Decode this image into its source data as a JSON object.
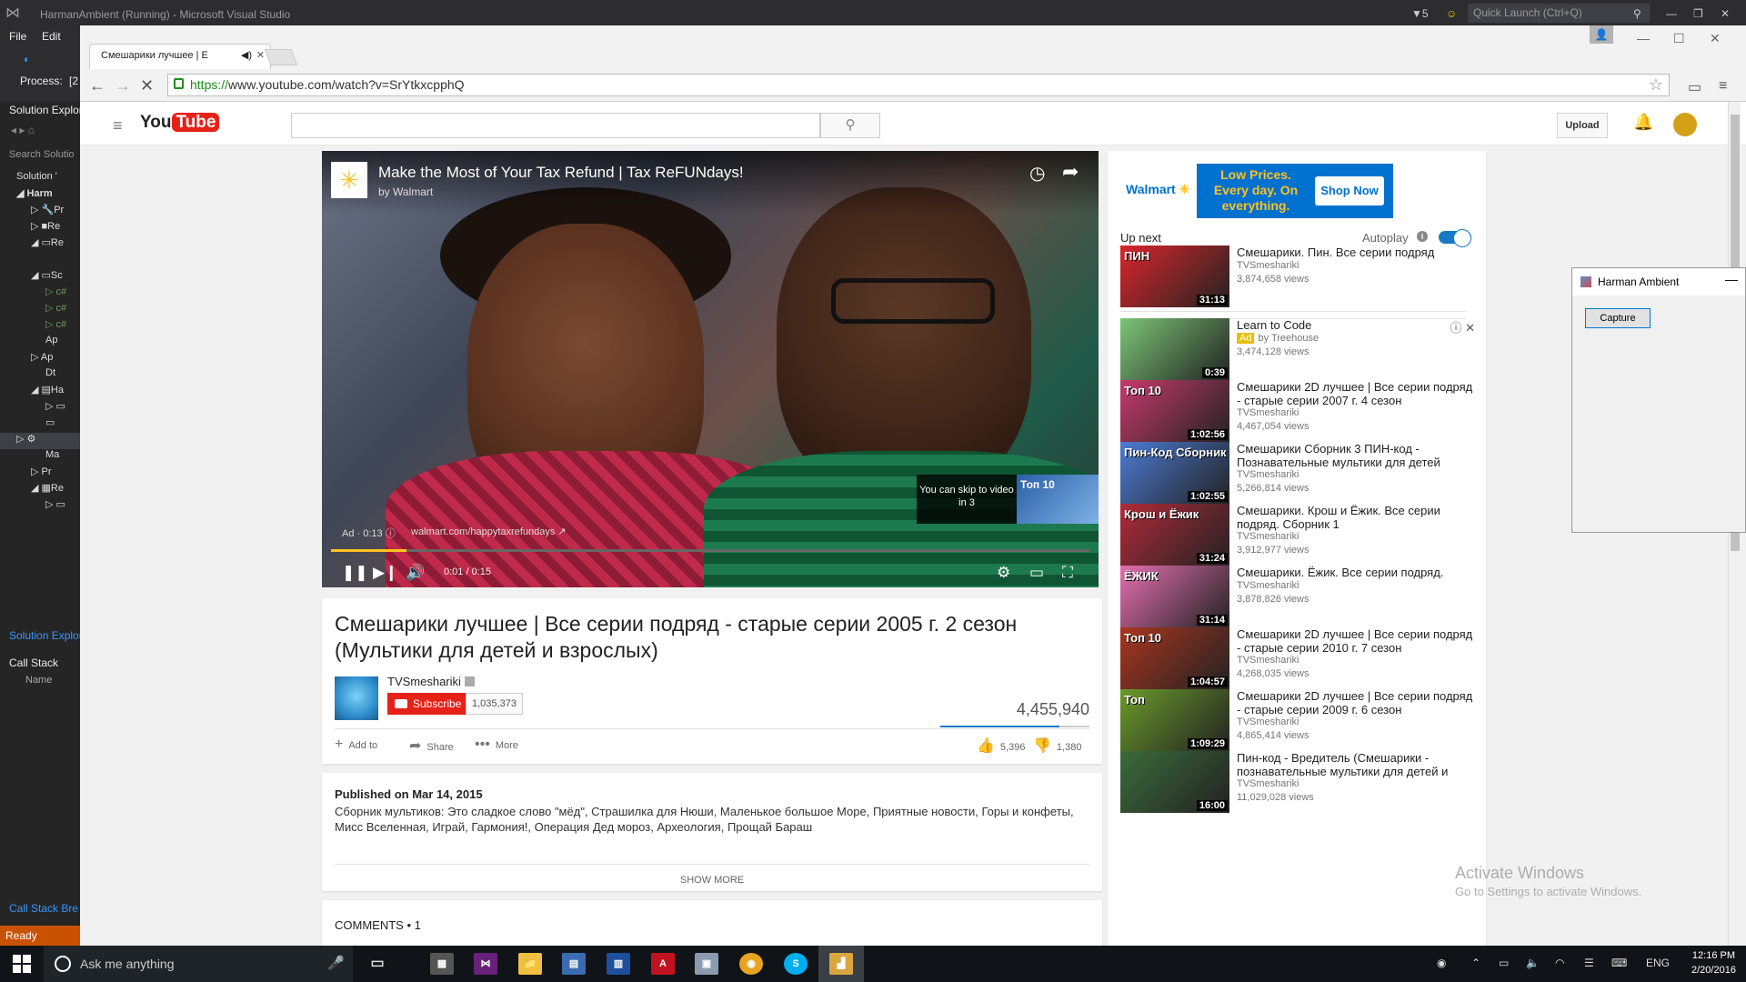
{
  "vs": {
    "title": "HarmanAmbient (Running) - Microsoft Visual Studio",
    "filter_count": "5",
    "quick_launch": "Quick Launch (Ctrl+Q)",
    "menu": [
      "File",
      "Edit"
    ],
    "process_label": "Process:",
    "process_value": "[2",
    "solution_explorer_title": "Solution Explor",
    "search_solution": "Search Solutio",
    "tree": [
      "Solution '",
      "Harm",
      "Pr",
      "Re",
      "Re",
      "",
      "Sc",
      "",
      "",
      "",
      "Ap",
      "Ap",
      "Dt",
      "Ha",
      "",
      "",
      "",
      "Ma",
      "Pr",
      "Re",
      ""
    ],
    "solution_tab": "Solution Explor",
    "call_stack_title": "Call Stack",
    "call_stack_col": "Name",
    "bottom_tabs": "Call Stack  Bre",
    "status": "Ready"
  },
  "browser": {
    "tab_title": "Смешарики лучшее | Е",
    "url_scheme": "https://",
    "url_rest": "www.youtube.com/watch?v=SrYtkxcpphQ"
  },
  "youtube": {
    "logo_you": "You",
    "logo_tube": "Tube",
    "search_placeholder": "",
    "upload": "Upload",
    "player": {
      "ad_title": "Make the Most of Your Tax Refund | Tax ReFUNdays!",
      "ad_by": "by Walmart",
      "skip_text": "You can skip to video in 3",
      "skip_thumb_text": "Топ 10",
      "ad_info": "Ad · 0:13",
      "ad_link": "walmart.com/happytaxrefundays",
      "time": "0:01 / 0:15",
      "progress": 0.1
    },
    "video": {
      "title": "Смешарики лучшее | Все серии подряд - старые серии 2005 г. 2 сезон (Мультики для детей и взрослых)",
      "channel": "TVSmeshariki",
      "subscribe": "Subscribe",
      "subscribers": "1,035,373",
      "views": "4,455,940",
      "like_ratio": 0.8,
      "add_to": "Add to",
      "share": "Share",
      "more": "More",
      "likes": "5,396",
      "dislikes": "1,380"
    },
    "description": {
      "published": "Published on Mar 14, 2015",
      "text": "Сборник мультиков: Это сладкое слово \"мёд\", Страшилка для Нюши, Маленькое большое Море, Приятные новости, Горы и конфеты, Мисс Вселенная, Играй, Гармония!, Операция Дед мороз, Археология, Прощай Бараш",
      "show_more": "SHOW MORE"
    },
    "comments": "COMMENTS • 1",
    "sidebar": {
      "banner_brand": "Walmart",
      "banner_tagline": "Low Prices. Every day. On everything.",
      "banner_cta": "Shop Now",
      "up_next": "Up next",
      "autoplay": "Autoplay",
      "videos": [
        {
          "title": "Смешарики. Пин. Все серии подряд",
          "channel": "TVSmeshariki",
          "views": "3,874,658 views",
          "duration": "31:13",
          "thumb_text": "ПИН",
          "color": "#d8262b"
        },
        {
          "title": "Learn to Code",
          "ad": "Ad",
          "channel": "by Treehouse",
          "views": "3,474,128 views",
          "duration": "0:39",
          "thumb_text": "",
          "color": "#7cc576"
        },
        {
          "title": "Смешарики 2D лучшее | Все серии подряд - старые серии 2007 г. 4 сезон",
          "channel": "TVSmeshariki",
          "views": "4,467,054 views",
          "duration": "1:02:56",
          "thumb_text": "Топ 10",
          "color": "#c73a6b"
        },
        {
          "title": "Смешарики Сборник 3 ПИН-код - Познавательные мультики для детей",
          "channel": "TVSmeshariki",
          "views": "5,266,814 views",
          "duration": "1:02:55",
          "thumb_text": "Пин-Код Сборник",
          "color": "#4c7bd4"
        },
        {
          "title": "Смешарики. Крош и Ёжик. Все серии подряд. Сборник 1",
          "channel": "TVSmeshariki",
          "views": "3,912,977 views",
          "duration": "31:24",
          "thumb_text": "Крош и Ёжик",
          "color": "#b12a3a"
        },
        {
          "title": "Смешарики. Ёжик. Все серии подряд.",
          "channel": "TVSmeshariki",
          "views": "3,878,826 views",
          "duration": "31:14",
          "thumb_text": "ЁЖИК",
          "color": "#e46fb0"
        },
        {
          "title": "Смешарики 2D лучшее | Все серии подряд - старые серии 2010 г. 7 сезон",
          "channel": "TVSmeshariki",
          "views": "4,268,035 views",
          "duration": "1:04:57",
          "thumb_text": "Топ 10",
          "color": "#a8351f"
        },
        {
          "title": "Смешарики 2D лучшее | Все серии подряд - старые серии 2009 г. 6 сезон",
          "channel": "TVSmeshariki",
          "views": "4,865,414 views",
          "duration": "1:09:29",
          "thumb_text": "Топ",
          "color": "#6b9a2a"
        },
        {
          "title": "Пин-код - Вредитель (Смешарики - познавательные мультики для детей и",
          "channel": "TVSmeshariki",
          "views": "11,029,028 views",
          "duration": "16:00",
          "thumb_text": "",
          "color": "#3b6b3b"
        }
      ]
    }
  },
  "watermark": {
    "line1": "Activate Windows",
    "line2": "Go to Settings to activate Windows."
  },
  "harman": {
    "title": "Harman Ambient",
    "capture": "Capture"
  },
  "taskbar": {
    "search": "Ask me anything",
    "lang": "ENG",
    "time": "12:16 PM",
    "date": "2/20/2016"
  }
}
